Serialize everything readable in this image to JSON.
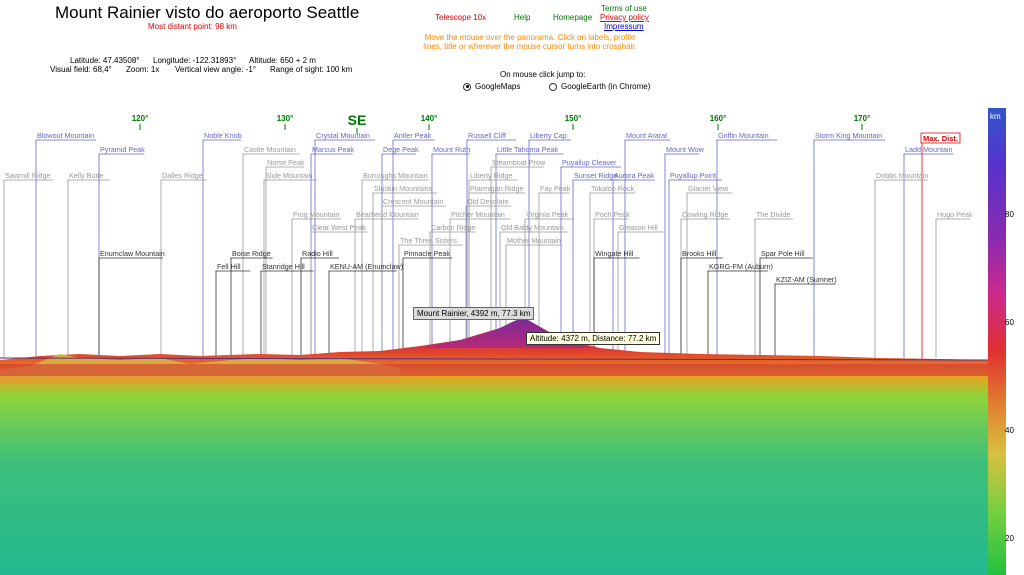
{
  "header": {
    "title": "Mount Rainier visto do aeroporto Seattle",
    "subtitle": "Most distant point: 98 km"
  },
  "info": {
    "latitude": "Latitude: 47.43508°",
    "longitude": "Longitude: -122.31893°",
    "altitude": "Altitude: 650 + 2 m",
    "visual_field": "Visual field: 68,4°",
    "zoom": "Zoom: 1x",
    "vertical_angle": "Vertical view angle: -1°",
    "range": "Range of sight: 100 km"
  },
  "links": {
    "telescope": "Telescope 10x",
    "help": "Help",
    "homepage": "Homepage",
    "terms": "Terms of use",
    "privacy": "Privacy policy",
    "impressum": "Impressum"
  },
  "hint": "Move the mouse over the panorama. Click on labels, profile lines, title or wherever the mouse cursor turns into crosshair.",
  "jump": {
    "label": "On mouse click jump to:",
    "option1": "GoogleMaps",
    "option2": "GoogleEarth (in Chrome)",
    "selected": "GoogleMaps"
  },
  "colors": {
    "label_blue": "#6666cc",
    "label_gray": "#999999",
    "label_black": "#333333",
    "compass_green": "#007700",
    "max_dist_red": "#e00000"
  },
  "compass": {
    "ticks": [
      "120°",
      "130°",
      "140°",
      "150°",
      "160°",
      "170°"
    ],
    "direction": "SE"
  },
  "peaks": {
    "blue": [
      "Blowout Mountain",
      "Noble Knob",
      "Crystal Mountain",
      "Antler Peak",
      "Russell Cliff",
      "Liberty Cap",
      "Mount Ararat",
      "Griffin Mountain",
      "Storm King Mountain",
      "Pyramid Peak",
      "Marcus Peak",
      "Dege Peak",
      "Mount Ruth",
      "Little Tahoma Peak",
      "Mount Wow",
      "Ladd Mountain",
      "Puyallup Cleaver",
      "Puyallup Point",
      "Sunset Ridge",
      "Aurora Peak"
    ],
    "gray": [
      "Sawmill Ridge",
      "Kelly Butte",
      "Dalles Ridge",
      "Castle Mountain",
      "Norse Peak",
      "Slide Mountain",
      "Burroughs Mountain",
      "Steamboat Prow",
      "Liberty Ridge",
      "Sluskin Mountains",
      "Ptarmigan Ridge",
      "Fay Peak",
      "Tokaloo Rock",
      "Glacier View",
      "Crescent Mountain",
      "Old Desolate",
      "Frog Mountain",
      "Bearhead Mountain",
      "Pitcher Mountain",
      "Virginia Peak",
      "Poch Peak",
      "The Divide",
      "Hugo Peak",
      "Dobbs Mountain",
      "Clear West Peak",
      "Carbon Ridge",
      "Old Baldy Mountain",
      "Gleason Hill",
      "Mother Mountain",
      "The Three Sisters",
      "Cowling Ridge"
    ],
    "black": [
      "Enumclaw Mountain",
      "Boise Ridge",
      "Radio Hill",
      "Pinnacle Peak",
      "Wingate Hill",
      "Brooks Hill",
      "Spar Pole Hill",
      "Fell Hill",
      "Stanridge Hill",
      "KENU-AM (Enumclaw)",
      "KGRG-FM (Auburn)",
      "KZIZ-AM (Sumner)"
    ],
    "max_dist": "Max. Dist."
  },
  "tooltips": {
    "peak": "Mount Rainier, 4392 m, 77.3 km",
    "cursor": "Altitude: 4372 m, Distance: 77.2 km"
  },
  "scale": {
    "unit": "km",
    "ticks": [
      "80",
      "60",
      "40",
      "20"
    ]
  }
}
